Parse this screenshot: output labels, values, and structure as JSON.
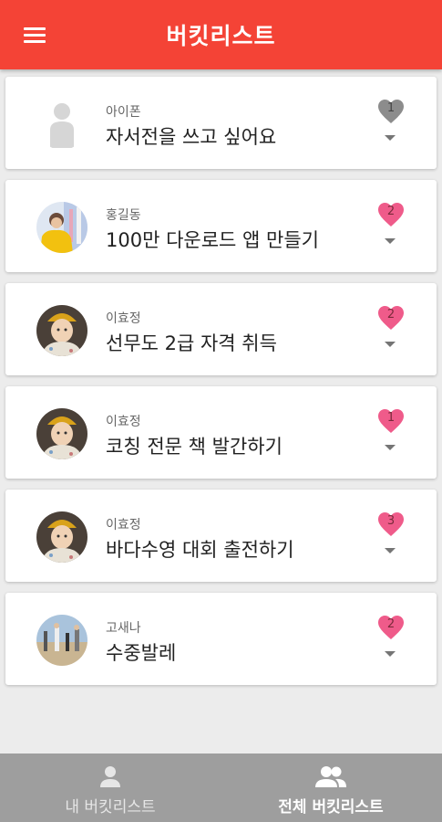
{
  "appbar": {
    "title": "버킷리스트",
    "menu_icon": "hamburger-menu-icon"
  },
  "colors": {
    "accent": "#f44336",
    "like": "#ef5b8a",
    "like_off": "#8c8c8c",
    "bottom_bar": "#9e9e9e"
  },
  "items": [
    {
      "user": "아이폰",
      "goal": "자서전을 쓰고 싶어요",
      "likes": "1",
      "liked": false,
      "avatar": "default-person-icon"
    },
    {
      "user": "홍길동",
      "goal": "100만 다운로드 앱 만들기",
      "likes": "2",
      "liked": true,
      "avatar": "profile-photo"
    },
    {
      "user": "이효정",
      "goal": "선무도 2급 자격 취득",
      "likes": "2",
      "liked": true,
      "avatar": "profile-photo"
    },
    {
      "user": "이효정",
      "goal": "코칭 전문 책 발간하기",
      "likes": "1",
      "liked": true,
      "avatar": "profile-photo"
    },
    {
      "user": "이효정",
      "goal": "바다수영 대회 출전하기",
      "likes": "3",
      "liked": true,
      "avatar": "profile-photo"
    },
    {
      "user": "고새나",
      "goal": "수중발레",
      "likes": "2",
      "liked": true,
      "avatar": "profile-photo"
    }
  ],
  "bottom_nav": [
    {
      "label": "내 버킷리스트",
      "icon": "person-icon",
      "active": false
    },
    {
      "label": "전체 버킷리스트",
      "icon": "people-icon",
      "active": true
    }
  ]
}
